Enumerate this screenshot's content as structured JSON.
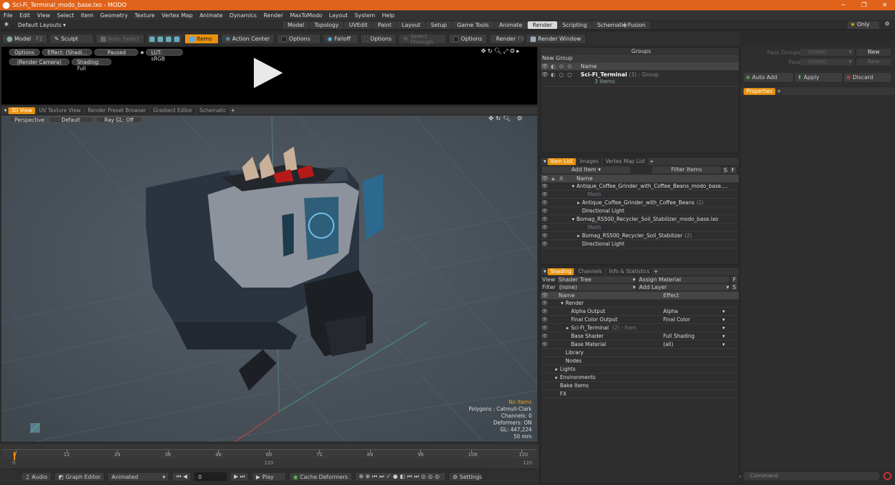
{
  "app": {
    "title": "Sci-Fi_Terminal_modo_base.lxo - MODO"
  },
  "menu": [
    "File",
    "Edit",
    "View",
    "Select",
    "Item",
    "Geometry",
    "Texture",
    "Vertex Map",
    "Animate",
    "Dynamics",
    "Render",
    "MaxToModo",
    "Layout",
    "System",
    "Help"
  ],
  "layout": {
    "label": "Default Layouts ▾",
    "tabs": [
      "Model",
      "Topology",
      "UVEdit",
      "Paint",
      "Layout",
      "Setup",
      "Game Tools",
      "Animate",
      "Render",
      "Scripting",
      "Schematic Fusion"
    ],
    "active_tab": "Render",
    "only": "Only"
  },
  "toolbar": {
    "model": "Model",
    "f2": "F2",
    "sculpt": "Sculpt",
    "auto_select": "Auto Select",
    "items": "Items",
    "action_center": "Action Center",
    "options1": "Options",
    "falloff": "Falloff",
    "options2": "Options",
    "select_through": "Select Through",
    "options3": "Options",
    "render": "Render",
    "render_f": "F9",
    "render_window": "Render Window"
  },
  "preview": {
    "options": "Options",
    "effect": "Effect: (Shadi...",
    "paused": "Paused",
    "lut": "LUT: sRGB",
    "camera": "(Render Camera)",
    "shading": "Shading: Full"
  },
  "viewport_tabs": [
    "3D View",
    "UV Texture View",
    "Render Preset Browser",
    "Gradient Editor",
    "Schematic"
  ],
  "viewport": {
    "perspective": "Perspective",
    "default": "Default",
    "raygl": "Ray GL: Off",
    "stats": [
      "No Items",
      "Polygons : Catmull-Clark",
      "Channels: 0",
      "Deformers: ON",
      "GL: 447,224",
      "50 mm"
    ]
  },
  "groups": {
    "title": "Groups",
    "new_group": "New Group",
    "col_name": "Name",
    "item_name": "Sci-Fi_Terminal",
    "item_suffix": "(3) : Group",
    "item_count": "3 Items"
  },
  "pass": {
    "pass_groups": "Pass Groups",
    "passes": "Passes",
    "none1": "(none)",
    "none2": "(none)",
    "new1": "New",
    "new2": "New"
  },
  "actions": {
    "auto_add": "Auto Add",
    "apply": "Apply",
    "discard": "Discard",
    "properties": "Properties"
  },
  "itemlist": {
    "tabs": [
      "Item List",
      "Images",
      "Vertex Map List"
    ],
    "add_item": "Add Item",
    "filter": "Filter Items",
    "col_name": "Name",
    "rows": [
      {
        "indent": 0,
        "text": "Antique_Coffee_Grinder_with_Coffee_Beans_modo_base....",
        "dim": false,
        "arrow": "▾"
      },
      {
        "indent": 2,
        "text": "Mesh",
        "dim": true,
        "arrow": ""
      },
      {
        "indent": 1,
        "text": "Antique_Coffee_Grinder_with_Coffee_Beans",
        "suffix": "(2)",
        "dim": false,
        "arrow": "▸"
      },
      {
        "indent": 1,
        "text": "Directional Light",
        "dim": false,
        "arrow": ""
      },
      {
        "indent": 0,
        "text": "Bomag_RS500_Recycler_Soil_Stabilizer_modo_base.lxo",
        "dim": false,
        "arrow": "▾"
      },
      {
        "indent": 2,
        "text": "Mesh",
        "dim": true,
        "arrow": ""
      },
      {
        "indent": 1,
        "text": "Bomag_RS500_Recycler_Soil_Stabilizer",
        "suffix": "(2)",
        "dim": false,
        "arrow": "▸"
      },
      {
        "indent": 1,
        "text": "Directional Light",
        "dim": false,
        "arrow": ""
      }
    ]
  },
  "shading": {
    "tabs": [
      "Shading",
      "Channels",
      "Info & Statistics"
    ],
    "view_label": "View",
    "view_value": "Shader Tree",
    "assign": "Assign Material",
    "filter_label": "Filter",
    "filter_value": "(none)",
    "add_layer": "Add Layer",
    "col_name": "Name",
    "col_effect": "Effect",
    "rows": [
      {
        "indent": 0,
        "text": "Render",
        "effect": "",
        "arrow": "▾"
      },
      {
        "indent": 1,
        "text": "Alpha Output",
        "effect": "Alpha",
        "arrow": ""
      },
      {
        "indent": 1,
        "text": "Final Color Output",
        "effect": "Final Color",
        "arrow": ""
      },
      {
        "indent": 1,
        "text": "Sci-Fi_Terminal",
        "suffix": "(2) : Item",
        "effect": "",
        "arrow": "▸"
      },
      {
        "indent": 1,
        "text": "Base Shader",
        "effect": "Full Shading",
        "arrow": ""
      },
      {
        "indent": 1,
        "text": "Base Material",
        "effect": "(all)",
        "arrow": ""
      },
      {
        "indent": 0,
        "text": "Library",
        "effect": "",
        "arrow": ""
      },
      {
        "indent": 0,
        "text": "Nodes",
        "effect": "",
        "arrow": ""
      },
      {
        "indent": -1,
        "text": "Lights",
        "effect": "",
        "arrow": "▸"
      },
      {
        "indent": -1,
        "text": "Environments",
        "effect": "",
        "arrow": "▸"
      },
      {
        "indent": -1,
        "text": "Bake Items",
        "effect": "",
        "arrow": ""
      },
      {
        "indent": -1,
        "text": "FX",
        "effect": "",
        "arrow": ""
      }
    ]
  },
  "timeline": {
    "ticks": [
      "0",
      "12",
      "24",
      "36",
      "48",
      "60",
      "72",
      "84",
      "96",
      "108",
      "120"
    ],
    "sub_left": "0",
    "sub_mid": "120",
    "sub_right": "120"
  },
  "bottom": {
    "audio": "Audio",
    "graph": "Graph Editor",
    "animated": "Animated",
    "frame": "0",
    "play": "Play",
    "cache": "Cache Deformers",
    "settings": "Settings"
  },
  "command": {
    "placeholder": "Command"
  }
}
